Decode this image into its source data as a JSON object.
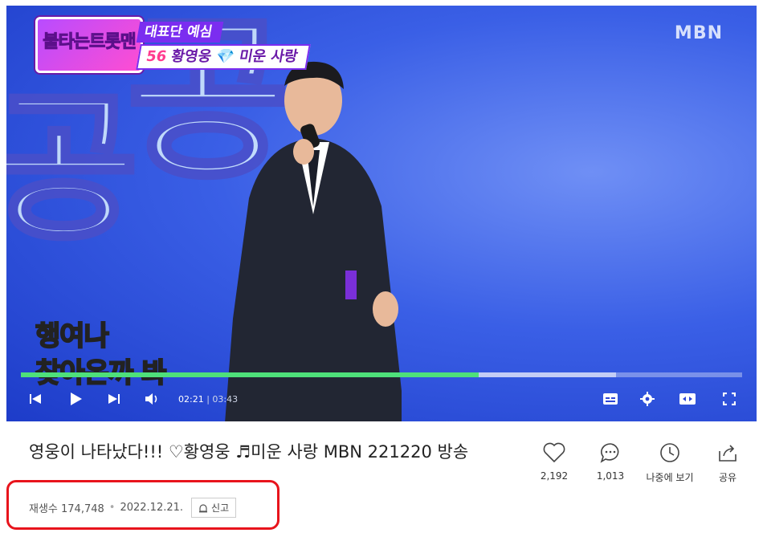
{
  "video": {
    "show_logo": "불타는트롯맨",
    "caption_top": "대표단 예심",
    "caption_num": "56",
    "caption_rest": "황영웅 💎 미운 사랑",
    "channel_watermark": "MBN",
    "subtitle_line1": "행여나",
    "subtitle_line2": "찾아온까 봐",
    "progress_fraction": 0.635,
    "buffer_fraction": 0.825,
    "current_time": "02:21",
    "duration": "03:43"
  },
  "title": "영웅이 나타났다!!! ♡황영웅 ♬미운 사랑 MBN 221220 방송",
  "meta": {
    "views": "재생수 174,748",
    "date": "2022.12.21.",
    "report_label": "신고"
  },
  "actions": {
    "like_count": "2,192",
    "comment_count": "1,013",
    "watch_later_label": "나중에 보기",
    "share_label": "공유"
  },
  "colors": {
    "progress": "#4ee07a",
    "highlight_box": "#e8141c"
  }
}
